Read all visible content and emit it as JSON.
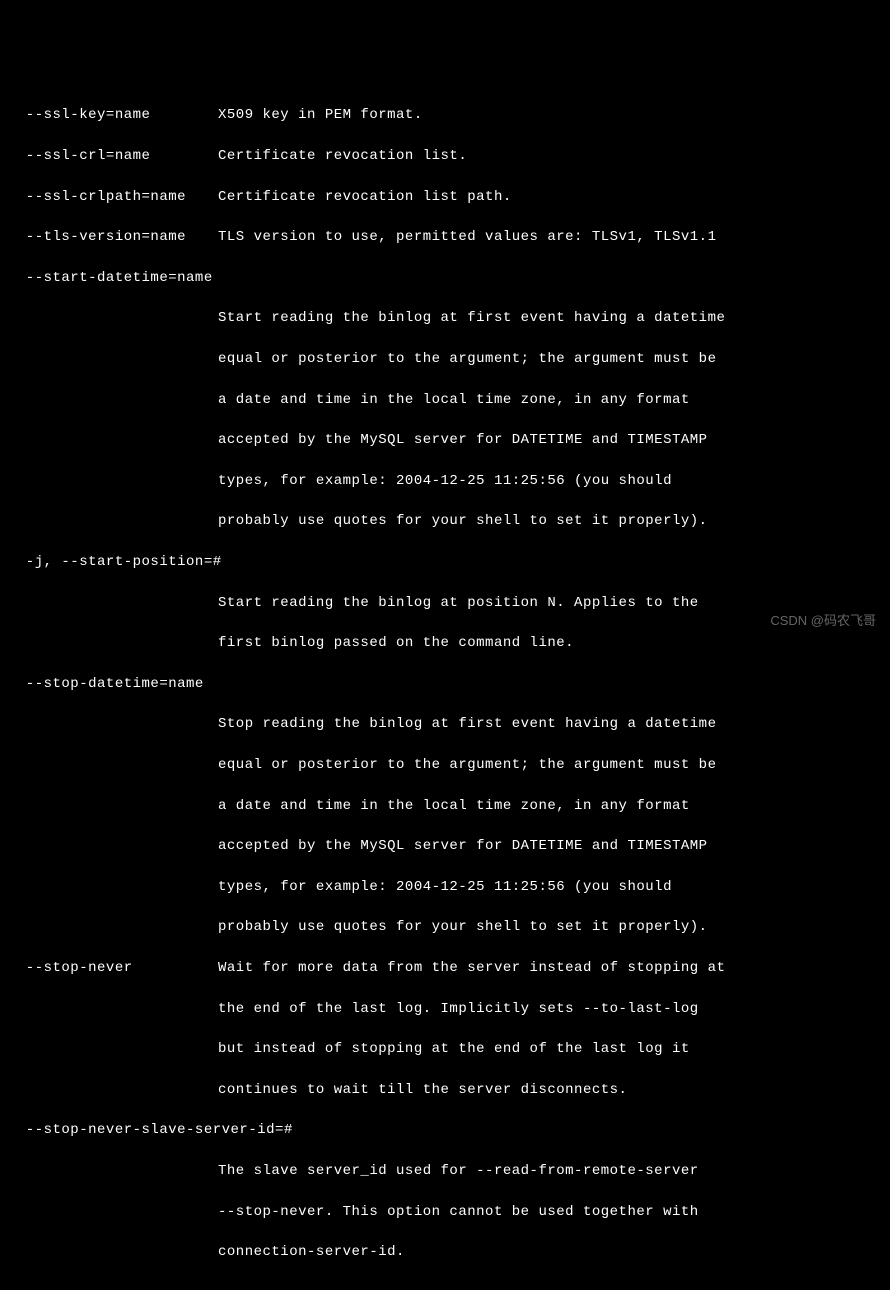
{
  "options": {
    "ssl_key": {
      "flag": "  --ssl-key=name",
      "desc": "X509 key in PEM format."
    },
    "ssl_crl": {
      "flag": "  --ssl-crl=name",
      "desc": "Certificate revocation list."
    },
    "ssl_crlpath": {
      "flag": "  --ssl-crlpath=name",
      "desc": "Certificate revocation list path."
    },
    "tls_version": {
      "flag": "  --tls-version=name",
      "desc": "TLS version to use, permitted values are: TLSv1, TLSv1.1"
    },
    "start_datetime": {
      "flag": "  --start-datetime=name",
      "l1": "Start reading the binlog at first event having a datetime",
      "l2": "equal or posterior to the argument; the argument must be",
      "l3": "a date and time in the local time zone, in any format",
      "l4": "accepted by the MySQL server for DATETIME and TIMESTAMP",
      "l5": "types, for example: 2004-12-25 11:25:56 (you should",
      "l6": "probably use quotes for your shell to set it properly)."
    },
    "start_position": {
      "flag": "  -j, --start-position=#",
      "l1": "Start reading the binlog at position N. Applies to the",
      "l2": "first binlog passed on the command line."
    },
    "stop_datetime": {
      "flag": "  --stop-datetime=name",
      "l1": "Stop reading the binlog at first event having a datetime",
      "l2": "equal or posterior to the argument; the argument must be",
      "l3": "a date and time in the local time zone, in any format",
      "l4": "accepted by the MySQL server for DATETIME and TIMESTAMP",
      "l5": "types, for example: 2004-12-25 11:25:56 (you should",
      "l6": "probably use quotes for your shell to set it properly)."
    },
    "stop_never": {
      "flag": "  --stop-never",
      "l1": "Wait for more data from the server instead of stopping at",
      "l2": "the end of the last log. Implicitly sets --to-last-log",
      "l3": "but instead of stopping at the end of the last log it",
      "l4": "continues to wait till the server disconnects."
    },
    "stop_never_slave": {
      "flag": "  --stop-never-slave-server-id=#",
      "l1": "The slave server_id used for --read-from-remote-server",
      "l2": "--stop-never. This option cannot be used together with",
      "l3": "connection-server-id."
    }
  },
  "watermark": "CSDN @码农飞哥"
}
